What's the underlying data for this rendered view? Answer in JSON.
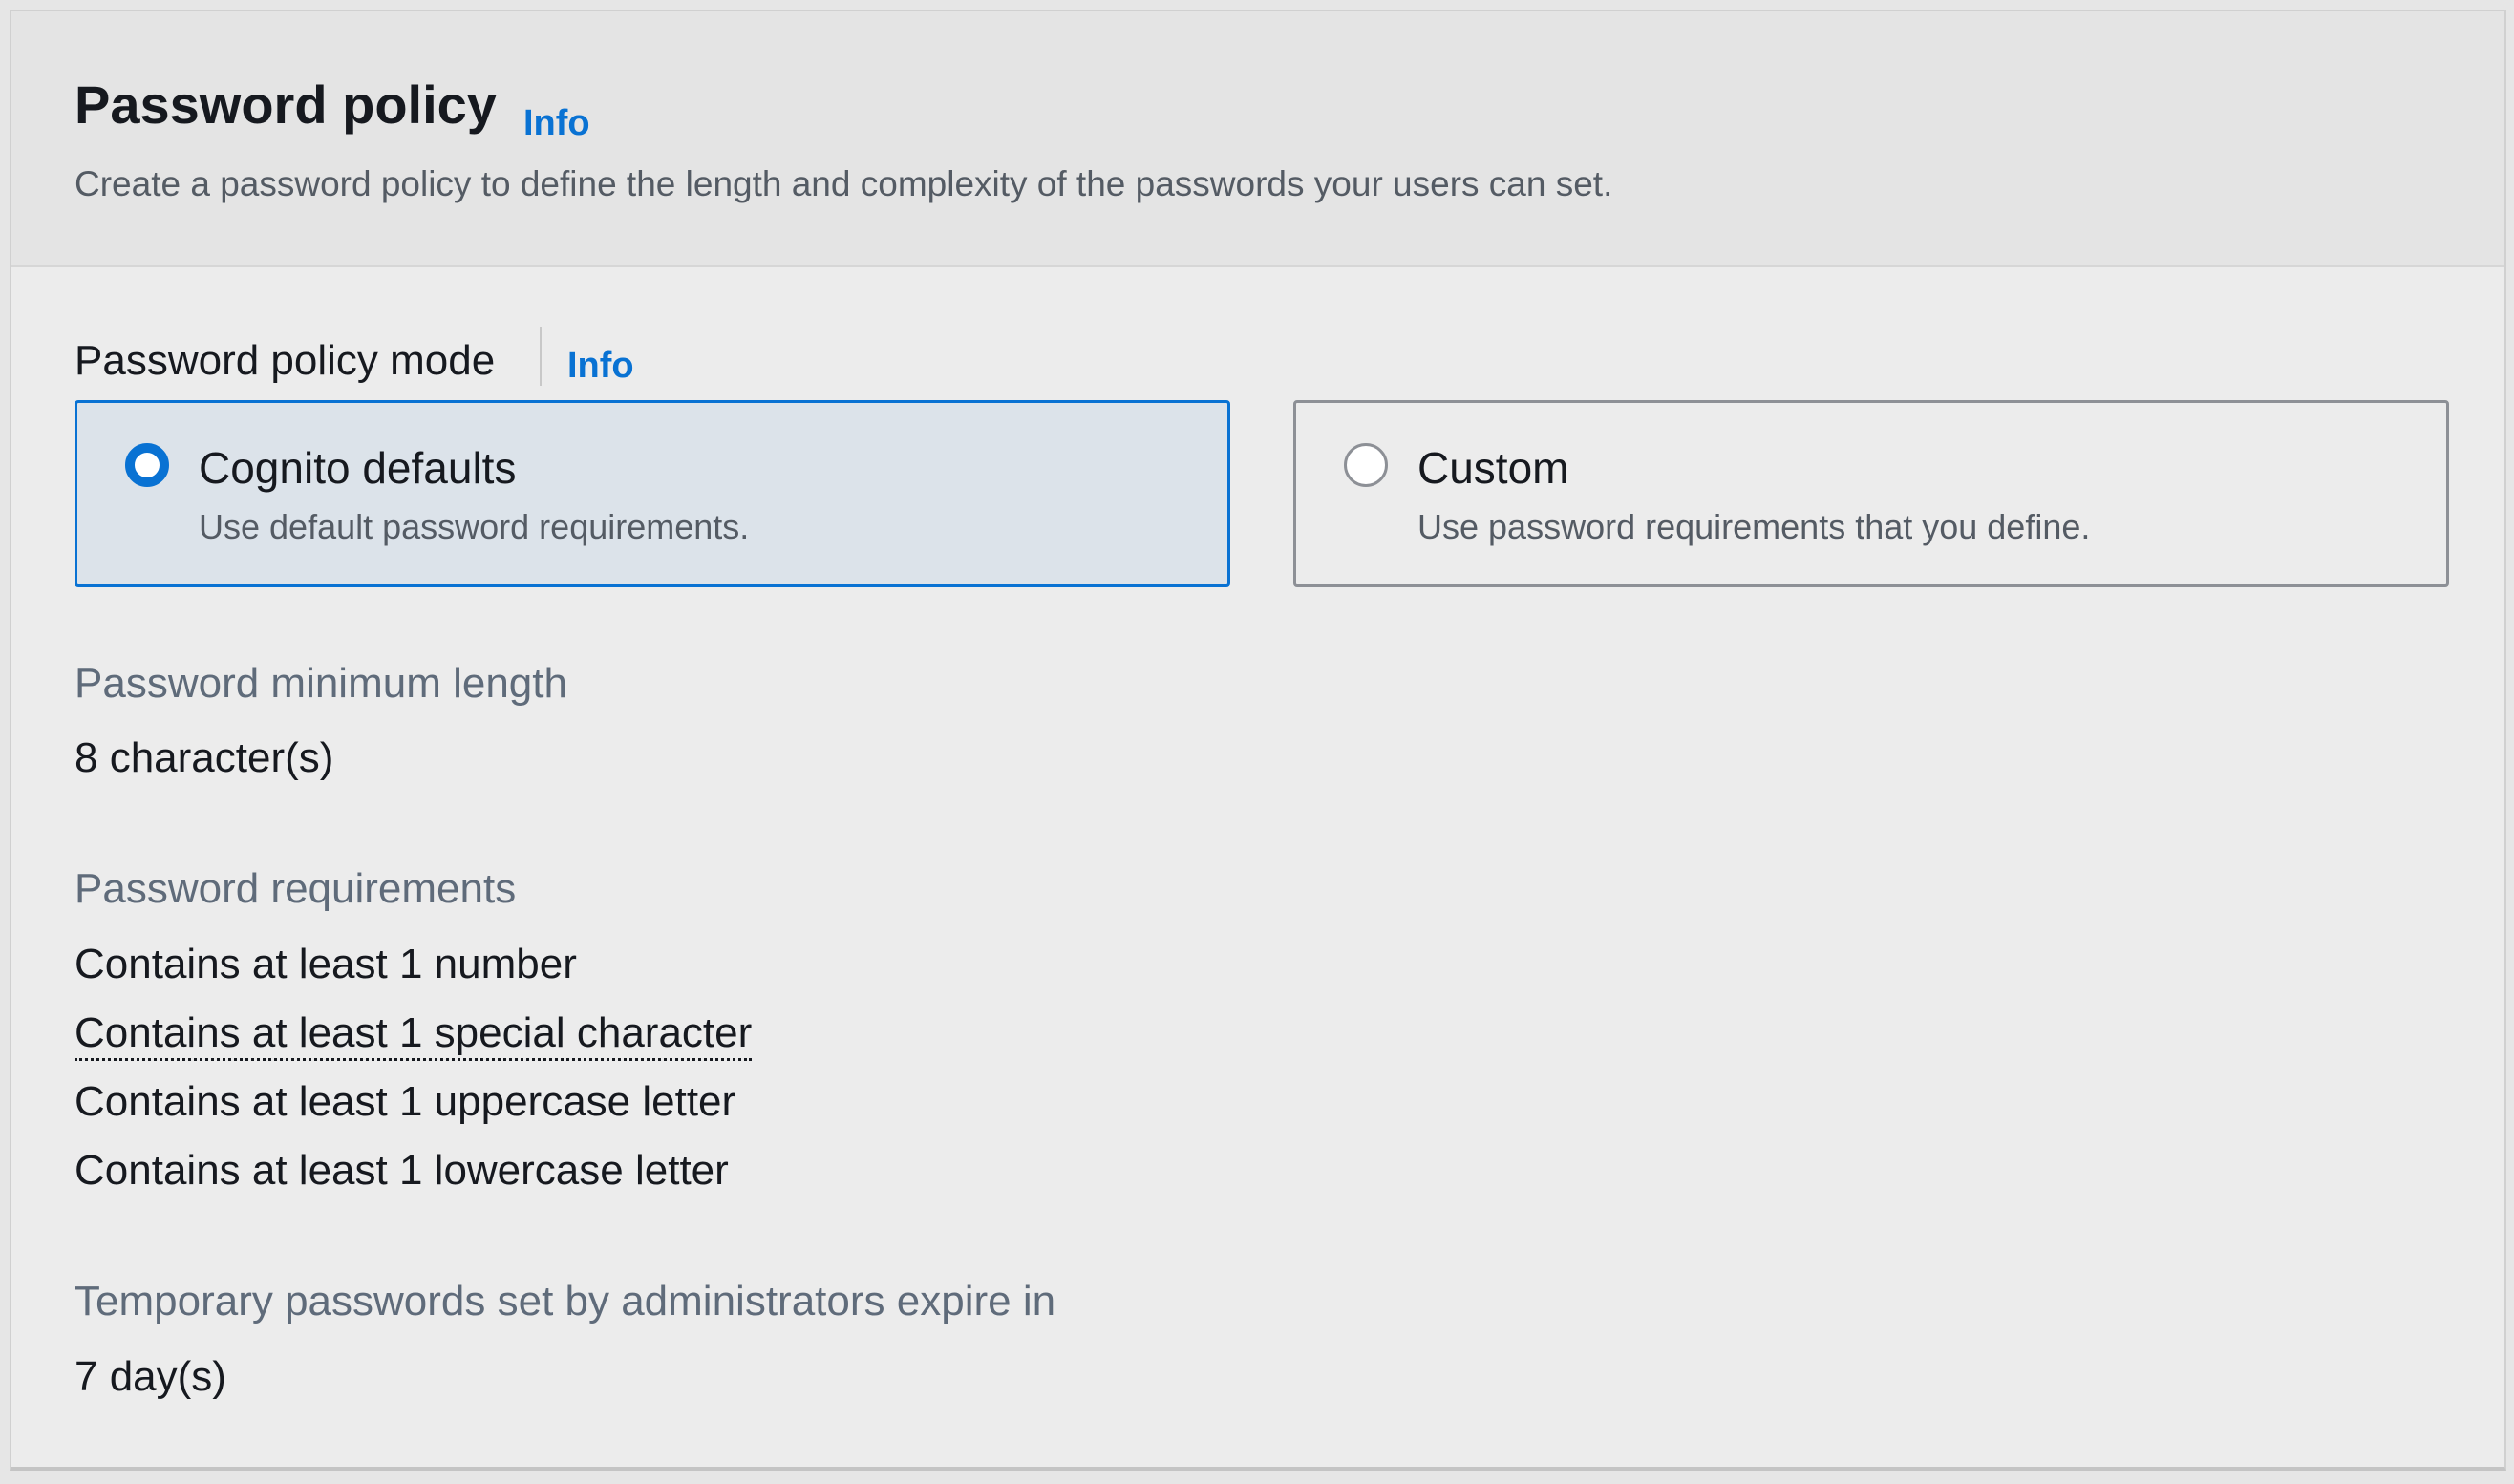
{
  "header": {
    "title": "Password policy",
    "info_label": "Info",
    "description": "Create a password policy to define the length and complexity of the passwords your users can set."
  },
  "mode": {
    "label": "Password policy mode",
    "info_label": "Info",
    "options": [
      {
        "label": "Cognito defaults",
        "description": "Use default password requirements.",
        "selected": true
      },
      {
        "label": "Custom",
        "description": "Use password requirements that you define.",
        "selected": false
      }
    ]
  },
  "min_length": {
    "label": "Password minimum length",
    "value": "8 character(s)"
  },
  "requirements": {
    "label": "Password requirements",
    "items": [
      "Contains at least 1 number",
      "Contains at least 1 special character",
      "Contains at least 1 uppercase letter",
      "Contains at least 1 lowercase letter"
    ]
  },
  "temp_expiry": {
    "label": "Temporary passwords set by administrators expire in",
    "value": "7 day(s)"
  },
  "colors": {
    "accent": "#0972d3",
    "selected_tile_bg": "#dce3ea",
    "text_primary": "#16191f",
    "text_secondary": "#545b64"
  }
}
